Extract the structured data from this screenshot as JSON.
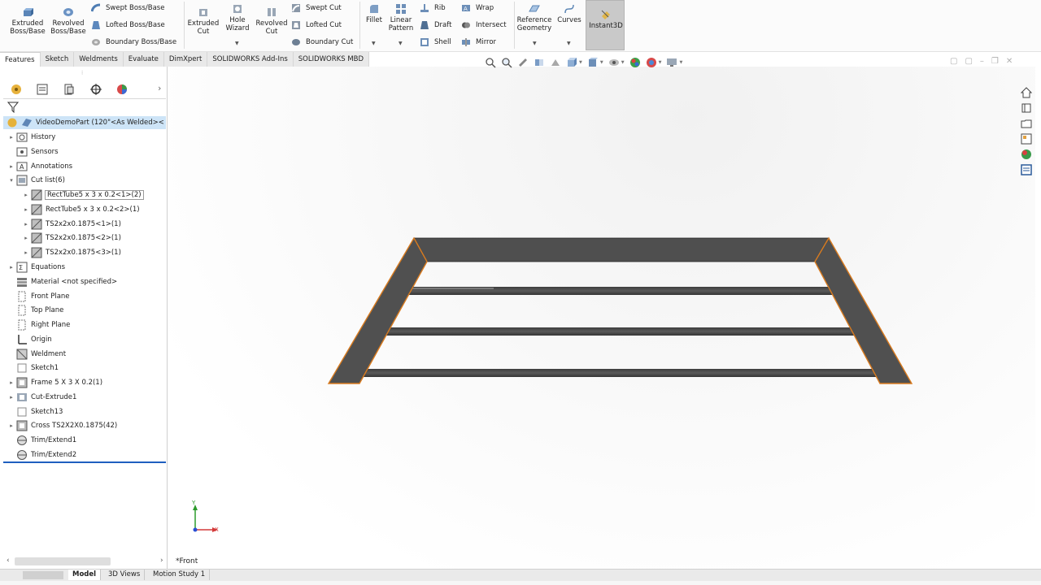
{
  "ribbon": {
    "extruded_boss": "Extruded\nBoss/Base",
    "revolved_boss": "Revolved\nBoss/Base",
    "swept_boss": "Swept Boss/Base",
    "lofted_boss": "Lofted Boss/Base",
    "boundary_boss": "Boundary Boss/Base",
    "extruded_cut": "Extruded\nCut",
    "hole_wizard": "Hole\nWizard",
    "revolved_cut": "Revolved\nCut",
    "swept_cut": "Swept Cut",
    "lofted_cut": "Lofted Cut",
    "boundary_cut": "Boundary Cut",
    "fillet": "Fillet",
    "linear_pattern": "Linear\nPattern",
    "rib": "Rib",
    "draft": "Draft",
    "shell": "Shell",
    "wrap": "Wrap",
    "intersect": "Intersect",
    "mirror": "Mirror",
    "reference_geometry": "Reference\nGeometry",
    "curves": "Curves",
    "instant3d": "Instant3D"
  },
  "tabs": [
    "Features",
    "Sketch",
    "Weldments",
    "Evaluate",
    "DimXpert",
    "SOLIDWORKS Add-Ins",
    "SOLIDWORKS MBD"
  ],
  "tree": {
    "root": "VideoDemoPart  (120\"<As Welded><",
    "items": [
      {
        "label": "History"
      },
      {
        "label": "Sensors"
      },
      {
        "label": "Annotations"
      },
      {
        "label": "Cut list(6)"
      },
      {
        "label": "RectTube5 x 3 x 0.2<1>(2)"
      },
      {
        "label": "RectTube5 x 3 x 0.2<2>(1)"
      },
      {
        "label": "TS2x2x0.1875<1>(1)"
      },
      {
        "label": "TS2x2x0.1875<2>(1)"
      },
      {
        "label": "TS2x2x0.1875<3>(1)"
      },
      {
        "label": "Equations"
      },
      {
        "label": "Material <not specified>"
      },
      {
        "label": "Front Plane"
      },
      {
        "label": "Top Plane"
      },
      {
        "label": "Right Plane"
      },
      {
        "label": "Origin"
      },
      {
        "label": "Weldment"
      },
      {
        "label": "Sketch1"
      },
      {
        "label": "Frame 5 X 3 X 0.2(1)"
      },
      {
        "label": "Cut-Extrude1"
      },
      {
        "label": "Sketch13"
      },
      {
        "label": "Cross TS2X2X0.1875(42)"
      },
      {
        "label": "Trim/Extend1"
      },
      {
        "label": "Trim/Extend2"
      }
    ]
  },
  "graphics": {
    "view_label": "*Front",
    "axis_x": "X",
    "axis_y": "Y"
  },
  "bottom_tabs": [
    "Model",
    "3D Views",
    "Motion Study 1"
  ]
}
